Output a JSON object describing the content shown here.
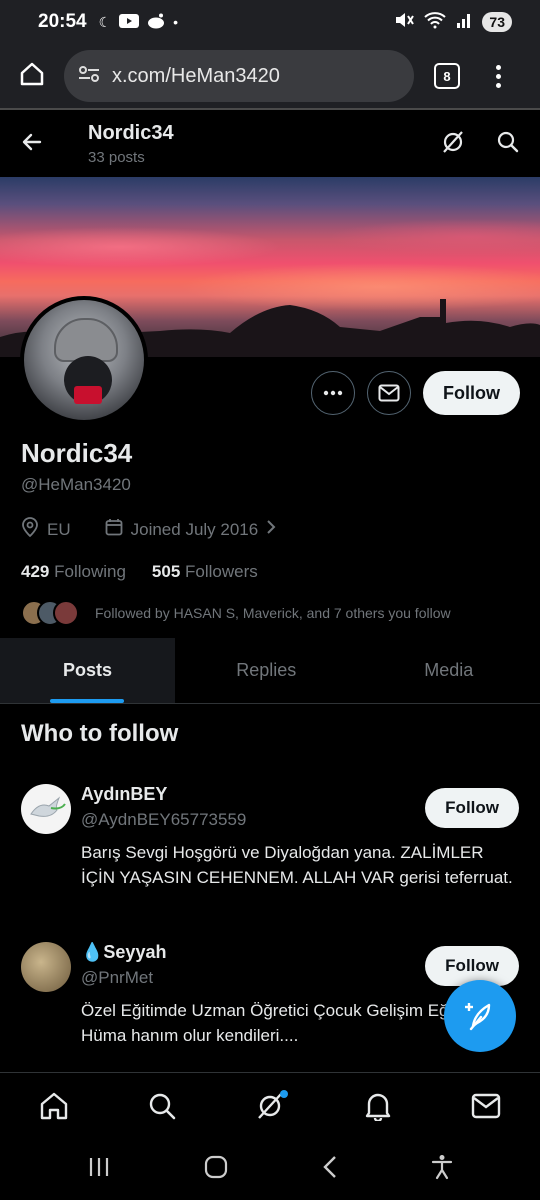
{
  "status_bar": {
    "time": "20:54",
    "battery": "73"
  },
  "browser": {
    "url": "x.com/HeMan3420",
    "tab_count": "8"
  },
  "profile_header": {
    "name": "Nordic34",
    "posts": "33 posts"
  },
  "profile": {
    "display_name": "Nordic34",
    "handle": "@HeMan3420",
    "location": "EU",
    "joined": "Joined July 2016",
    "following_count": "429",
    "following_label": "Following",
    "followers_count": "505",
    "followers_label": "Followers",
    "followed_by": "Followed by HASAN S, Maverick, and 7 others you follow",
    "follow_button": "Follow"
  },
  "tabs": [
    {
      "label": "Posts",
      "active": true
    },
    {
      "label": "Replies",
      "active": false
    },
    {
      "label": "Media",
      "active": false
    }
  ],
  "who_to_follow": {
    "title": "Who to follow",
    "users": [
      {
        "name": "AydınBEY",
        "handle": "@AydnBEY65773559",
        "bio": "Barış Sevgi Hoşgörü ve Diyaloğdan yana. ZALİMLER İÇİN YAŞASIN CEHENNEM. ALLAH VAR gerisi teferruat.",
        "button": "Follow"
      },
      {
        "name": "💧Seyyah",
        "handle": "@PnrMet",
        "bio": "Özel Eğitimde Uzman Öğretici Çocuk Gelişim Eğitimcisi Hüma hanım olur kendileri....",
        "button": "Follow"
      }
    ]
  },
  "colors": {
    "accent": "#1d9bf0",
    "background": "#000000",
    "text_primary": "#e7e9ea",
    "text_secondary": "#71767b"
  }
}
